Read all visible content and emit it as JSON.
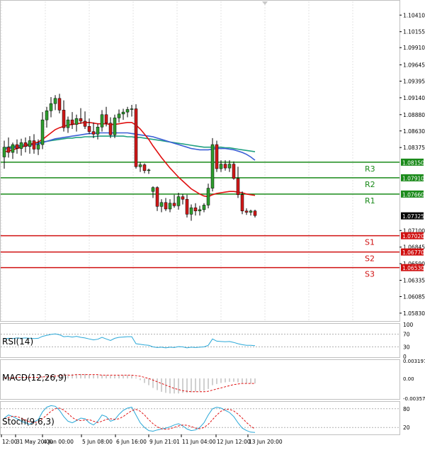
{
  "chart_data": {
    "type": "candlestick",
    "instrument_note": "",
    "colors": {
      "bull": "#2e9e2e",
      "bear": "#d01818",
      "ma_fast": "#e01010",
      "ma_mid": "#3b5fd6",
      "ma_slow": "#20a080",
      "resistance": "#1a8a1a",
      "support": "#d01010",
      "indicator": "#2aa8d8",
      "signal": "#e01010",
      "grid": "#e3e3e3",
      "axis_text": "#000000"
    },
    "price_axis": {
      "ylim": [
        1.0572,
        1.1062
      ],
      "ticks": [
        "1.10410",
        "1.10155",
        "1.09910",
        "1.09645",
        "1.09395",
        "1.09140",
        "1.08880",
        "1.08630",
        "1.08375",
        "1.07100",
        "1.06845",
        "1.06590",
        "1.06335",
        "1.06085",
        "1.05830"
      ],
      "tick_values": [
        1.1041,
        1.10155,
        1.0991,
        1.09645,
        1.09395,
        1.0914,
        1.0888,
        1.0863,
        1.08375,
        1.071,
        1.06845,
        1.0659,
        1.06335,
        1.06085,
        1.0583
      ]
    },
    "levels": [
      {
        "label": "R3",
        "value": 1.0815,
        "price_label": "1.08150",
        "kind": "resistance"
      },
      {
        "label": "R2",
        "value": 1.0791,
        "price_label": "1.07910",
        "kind": "resistance"
      },
      {
        "label": "R1",
        "value": 1.0766,
        "price_label": "1.07660",
        "kind": "resistance"
      },
      {
        "label": "S1",
        "value": 1.0702,
        "price_label": "1.07020",
        "kind": "support"
      },
      {
        "label": "S2",
        "value": 1.0677,
        "price_label": "1.06770",
        "kind": "support"
      },
      {
        "label": "S3",
        "value": 1.0653,
        "price_label": "1.06530",
        "kind": "support"
      }
    ],
    "last_price": {
      "value": 1.07325,
      "label": "1.07325"
    },
    "x_ticks": [
      "12:00",
      "31 May 20:00",
      "4 Jun 00:00",
      "5 Jun 08:00",
      "6 Jun 16:00",
      "9 Jun 21:01",
      "11 Jun 04:00",
      "12 Jun 12:00",
      "13 Jun 20:00"
    ],
    "candles": [
      {
        "o": 1.0823,
        "h": 1.0848,
        "l": 1.0805,
        "c": 1.0838
      },
      {
        "o": 1.0838,
        "h": 1.0853,
        "l": 1.0822,
        "c": 1.083
      },
      {
        "o": 1.083,
        "h": 1.0845,
        "l": 1.082,
        "c": 1.0842
      },
      {
        "o": 1.0842,
        "h": 1.085,
        "l": 1.0828,
        "c": 1.0836
      },
      {
        "o": 1.0836,
        "h": 1.0851,
        "l": 1.0825,
        "c": 1.0845
      },
      {
        "o": 1.0845,
        "h": 1.0853,
        "l": 1.083,
        "c": 1.0839
      },
      {
        "o": 1.0839,
        "h": 1.0855,
        "l": 1.0828,
        "c": 1.0848
      },
      {
        "o": 1.0848,
        "h": 1.0858,
        "l": 1.0828,
        "c": 1.0835
      },
      {
        "o": 1.0835,
        "h": 1.085,
        "l": 1.0826,
        "c": 1.0842
      },
      {
        "o": 1.0842,
        "h": 1.0892,
        "l": 1.0835,
        "c": 1.088
      },
      {
        "o": 1.088,
        "h": 1.09,
        "l": 1.0868,
        "c": 1.0894
      },
      {
        "o": 1.0894,
        "h": 1.0915,
        "l": 1.0884,
        "c": 1.0905
      },
      {
        "o": 1.0905,
        "h": 1.0918,
        "l": 1.0895,
        "c": 1.0913
      },
      {
        "o": 1.0913,
        "h": 1.092,
        "l": 1.089,
        "c": 1.0895
      },
      {
        "o": 1.0895,
        "h": 1.091,
        "l": 1.0862,
        "c": 1.0868
      },
      {
        "o": 1.0868,
        "h": 1.0885,
        "l": 1.086,
        "c": 1.088
      },
      {
        "o": 1.088,
        "h": 1.0892,
        "l": 1.0866,
        "c": 1.0873
      },
      {
        "o": 1.0873,
        "h": 1.0888,
        "l": 1.0862,
        "c": 1.0882
      },
      {
        "o": 1.0882,
        "h": 1.0898,
        "l": 1.0874,
        "c": 1.0878
      },
      {
        "o": 1.0878,
        "h": 1.0893,
        "l": 1.0866,
        "c": 1.087
      },
      {
        "o": 1.087,
        "h": 1.0882,
        "l": 1.0858,
        "c": 1.0862
      },
      {
        "o": 1.0862,
        "h": 1.0876,
        "l": 1.0852,
        "c": 1.0858
      },
      {
        "o": 1.0858,
        "h": 1.0874,
        "l": 1.085,
        "c": 1.0869
      },
      {
        "o": 1.0869,
        "h": 1.0895,
        "l": 1.0862,
        "c": 1.0888
      },
      {
        "o": 1.0888,
        "h": 1.09,
        "l": 1.087,
        "c": 1.0875
      },
      {
        "o": 1.0875,
        "h": 1.0884,
        "l": 1.0852,
        "c": 1.0857
      },
      {
        "o": 1.0857,
        "h": 1.0888,
        "l": 1.0852,
        "c": 1.0883
      },
      {
        "o": 1.0883,
        "h": 1.0896,
        "l": 1.0876,
        "c": 1.0889
      },
      {
        "o": 1.0889,
        "h": 1.0897,
        "l": 1.088,
        "c": 1.0892
      },
      {
        "o": 1.0892,
        "h": 1.09,
        "l": 1.0884,
        "c": 1.0896
      },
      {
        "o": 1.0896,
        "h": 1.0903,
        "l": 1.0885,
        "c": 1.0897
      },
      {
        "o": 1.0897,
        "h": 1.0904,
        "l": 1.0805,
        "c": 1.0808
      },
      {
        "o": 1.0808,
        "h": 1.0815,
        "l": 1.08,
        "c": 1.0811
      },
      {
        "o": 1.0811,
        "h": 1.0813,
        "l": 1.0798,
        "c": 1.0802
      },
      {
        "o": 1.0802,
        "h": 1.0805,
        "l": 1.0797,
        "c": 1.0803
      },
      {
        "o": 1.077,
        "h": 1.0778,
        "l": 1.076,
        "c": 1.0776
      },
      {
        "o": 1.0776,
        "h": 1.0778,
        "l": 1.074,
        "c": 1.0747
      },
      {
        "o": 1.0747,
        "h": 1.0758,
        "l": 1.0738,
        "c": 1.0753
      },
      {
        "o": 1.0753,
        "h": 1.076,
        "l": 1.074,
        "c": 1.0743
      },
      {
        "o": 1.0743,
        "h": 1.0758,
        "l": 1.0738,
        "c": 1.0752
      },
      {
        "o": 1.0752,
        "h": 1.0765,
        "l": 1.0745,
        "c": 1.0748
      },
      {
        "o": 1.0748,
        "h": 1.0768,
        "l": 1.0742,
        "c": 1.0762
      },
      {
        "o": 1.0762,
        "h": 1.0766,
        "l": 1.075,
        "c": 1.0758
      },
      {
        "o": 1.0758,
        "h": 1.0765,
        "l": 1.073,
        "c": 1.0735
      },
      {
        "o": 1.0735,
        "h": 1.075,
        "l": 1.0725,
        "c": 1.0745
      },
      {
        "o": 1.0745,
        "h": 1.0752,
        "l": 1.0733,
        "c": 1.074
      },
      {
        "o": 1.074,
        "h": 1.0748,
        "l": 1.0733,
        "c": 1.0742
      },
      {
        "o": 1.0742,
        "h": 1.0752,
        "l": 1.0738,
        "c": 1.0749
      },
      {
        "o": 1.0749,
        "h": 1.0782,
        "l": 1.0744,
        "c": 1.0775
      },
      {
        "o": 1.0775,
        "h": 1.0852,
        "l": 1.077,
        "c": 1.0842
      },
      {
        "o": 1.0842,
        "h": 1.0848,
        "l": 1.08,
        "c": 1.0805
      },
      {
        "o": 1.0805,
        "h": 1.0818,
        "l": 1.08,
        "c": 1.0812
      },
      {
        "o": 1.0812,
        "h": 1.0818,
        "l": 1.0802,
        "c": 1.0806
      },
      {
        "o": 1.0806,
        "h": 1.0818,
        "l": 1.08,
        "c": 1.0812
      },
      {
        "o": 1.0812,
        "h": 1.0816,
        "l": 1.0788,
        "c": 1.079
      },
      {
        "o": 1.079,
        "h": 1.0808,
        "l": 1.076,
        "c": 1.0765
      },
      {
        "o": 1.0765,
        "h": 1.077,
        "l": 1.0735,
        "c": 1.074
      },
      {
        "o": 1.074,
        "h": 1.0744,
        "l": 1.0734,
        "c": 1.0738
      },
      {
        "o": 1.0738,
        "h": 1.0742,
        "l": 1.0733,
        "c": 1.074
      },
      {
        "o": 1.074,
        "h": 1.0742,
        "l": 1.073,
        "c": 1.0733
      }
    ],
    "ma_fast": [
      1.0831,
      1.0832,
      1.0834,
      1.0836,
      1.0838,
      1.084,
      1.0842,
      1.0844,
      1.0846,
      1.085,
      1.0855,
      1.086,
      1.0865,
      1.0868,
      1.087,
      1.0872,
      1.0873,
      1.0874,
      1.0875,
      1.0876,
      1.0876,
      1.0875,
      1.0874,
      1.0874,
      1.0874,
      1.0873,
      1.0873,
      1.0874,
      1.0875,
      1.0876,
      1.0876,
      1.0872,
      1.0866,
      1.0858,
      1.085,
      1.084,
      1.0831,
      1.0822,
      1.0814,
      1.0806,
      1.0799,
      1.0792,
      1.0786,
      1.078,
      1.0774,
      1.077,
      1.0766,
      1.0763,
      1.0762,
      1.0765,
      1.0767,
      1.0768,
      1.0769,
      1.077,
      1.077,
      1.0769,
      1.0768,
      1.0766,
      1.0765,
      1.0764
    ],
    "ma_mid": [
      1.0835,
      1.0836,
      1.0837,
      1.0838,
      1.0839,
      1.084,
      1.0841,
      1.0842,
      1.0843,
      1.0845,
      1.0847,
      1.0849,
      1.0851,
      1.0852,
      1.0853,
      1.0854,
      1.0855,
      1.0856,
      1.0857,
      1.0858,
      1.0859,
      1.0859,
      1.086,
      1.086,
      1.086,
      1.086,
      1.086,
      1.086,
      1.086,
      1.086,
      1.0859,
      1.0858,
      1.0857,
      1.0856,
      1.0855,
      1.0854,
      1.0852,
      1.085,
      1.0848,
      1.0846,
      1.0844,
      1.0842,
      1.084,
      1.0838,
      1.0836,
      1.0835,
      1.0834,
      1.0834,
      1.0834,
      1.0835,
      1.0836,
      1.0836,
      1.0836,
      1.0835,
      1.0834,
      1.0832,
      1.083,
      1.0827,
      1.0823,
      1.0818
    ],
    "ma_slow": [
      1.0837,
      1.0838,
      1.0839,
      1.084,
      1.0841,
      1.0842,
      1.0843,
      1.0844,
      1.0845,
      1.0846,
      1.0847,
      1.0848,
      1.0849,
      1.085,
      1.0851,
      1.0852,
      1.0852,
      1.0853,
      1.0853,
      1.0854,
      1.0854,
      1.0854,
      1.0855,
      1.0855,
      1.0855,
      1.0855,
      1.0855,
      1.0855,
      1.0855,
      1.0854,
      1.0854,
      1.0853,
      1.0853,
      1.0852,
      1.0851,
      1.085,
      1.0849,
      1.0848,
      1.0847,
      1.0846,
      1.0845,
      1.0844,
      1.0843,
      1.0842,
      1.0841,
      1.084,
      1.0839,
      1.0838,
      1.0838,
      1.0838,
      1.0838,
      1.0838,
      1.0837,
      1.0837,
      1.0836,
      1.0835,
      1.0834,
      1.0833,
      1.0832,
      1.0831
    ],
    "rsi": {
      "label": "RSI(14)",
      "ylim": [
        0,
        100
      ],
      "ticks": [
        "100",
        "70",
        "30",
        "0"
      ],
      "tick_values": [
        100,
        70,
        30,
        0
      ],
      "values": [
        55,
        57,
        56,
        58,
        57,
        58,
        57,
        56,
        57,
        63,
        66,
        69,
        71,
        68,
        62,
        63,
        61,
        63,
        60,
        58,
        55,
        52,
        54,
        60,
        55,
        50,
        57,
        60,
        61,
        62,
        62,
        40,
        38,
        36,
        35,
        30,
        28,
        29,
        27,
        29,
        28,
        31,
        30,
        27,
        29,
        28,
        29,
        30,
        35,
        55,
        48,
        47,
        46,
        47,
        44,
        40,
        37,
        35,
        35,
        34
      ]
    },
    "macd": {
      "label": "MACD(12,26,9)",
      "ticks": [
        "0.003197",
        "0.00",
        "-0.003573"
      ],
      "tick_values": [
        0.003197,
        0.0,
        -0.003573
      ],
      "ylim": [
        -0.00357,
        0.0032
      ],
      "histogram": [
        0.0002,
        0.0002,
        0.0003,
        0.0003,
        0.0003,
        0.0003,
        0.0003,
        0.0003,
        0.0003,
        0.0004,
        0.0005,
        0.0006,
        0.0007,
        0.0008,
        0.0008,
        0.0008,
        0.0008,
        0.0008,
        0.0008,
        0.0008,
        0.0007,
        0.0006,
        0.0006,
        0.0006,
        0.0006,
        0.0005,
        0.0005,
        0.0006,
        0.0006,
        0.0006,
        0.0006,
        0.0002,
        -0.0003,
        -0.0008,
        -0.0012,
        -0.0017,
        -0.0021,
        -0.0024,
        -0.0026,
        -0.0027,
        -0.0027,
        -0.0027,
        -0.0026,
        -0.0026,
        -0.0025,
        -0.0024,
        -0.0023,
        -0.0022,
        -0.0019,
        -0.0012,
        -0.001,
        -0.0008,
        -0.0007,
        -0.0006,
        -0.0006,
        -0.0007,
        -0.0008,
        -0.0009,
        -0.0009,
        -0.0009
      ],
      "signal": [
        0.0001,
        0.0001,
        0.0001,
        0.0002,
        0.0002,
        0.0002,
        0.0002,
        0.0002,
        0.0002,
        0.0003,
        0.0003,
        0.0004,
        0.0004,
        0.0005,
        0.0006,
        0.0006,
        0.0006,
        0.0007,
        0.0007,
        0.0007,
        0.0007,
        0.0007,
        0.0007,
        0.0006,
        0.0006,
        0.0006,
        0.0006,
        0.0006,
        0.0006,
        0.0006,
        0.0006,
        0.0005,
        0.0004,
        0.0002,
        0.0,
        -0.0003,
        -0.0006,
        -0.0009,
        -0.0012,
        -0.0015,
        -0.0018,
        -0.002,
        -0.0022,
        -0.0023,
        -0.0024,
        -0.0024,
        -0.0024,
        -0.0024,
        -0.0023,
        -0.0021,
        -0.0019,
        -0.0017,
        -0.0015,
        -0.0013,
        -0.0011,
        -0.001,
        -0.0009,
        -0.0009,
        -0.0009,
        -0.0009
      ]
    },
    "stoch": {
      "label": "Stoch(9,6,3)",
      "ylim": [
        0,
        100
      ],
      "ticks": [
        "80",
        "20"
      ],
      "tick_values": [
        80,
        20
      ],
      "main": [
        50,
        60,
        55,
        48,
        40,
        35,
        30,
        38,
        45,
        70,
        85,
        90,
        88,
        75,
        55,
        40,
        35,
        42,
        50,
        48,
        35,
        28,
        40,
        60,
        55,
        40,
        45,
        62,
        75,
        82,
        85,
        60,
        35,
        20,
        10,
        8,
        12,
        15,
        18,
        22,
        28,
        32,
        25,
        15,
        10,
        12,
        20,
        35,
        60,
        80,
        85,
        82,
        75,
        68,
        55,
        35,
        18,
        10,
        5,
        4
      ],
      "signal": [
        48,
        52,
        56,
        55,
        50,
        44,
        38,
        36,
        38,
        48,
        60,
        72,
        80,
        82,
        76,
        65,
        52,
        44,
        42,
        44,
        45,
        40,
        36,
        40,
        46,
        48,
        46,
        48,
        55,
        65,
        74,
        78,
        72,
        60,
        45,
        32,
        22,
        16,
        14,
        16,
        20,
        25,
        28,
        27,
        23,
        18,
        16,
        20,
        30,
        45,
        60,
        72,
        78,
        78,
        73,
        63,
        50,
        36,
        24,
        15
      ]
    }
  }
}
